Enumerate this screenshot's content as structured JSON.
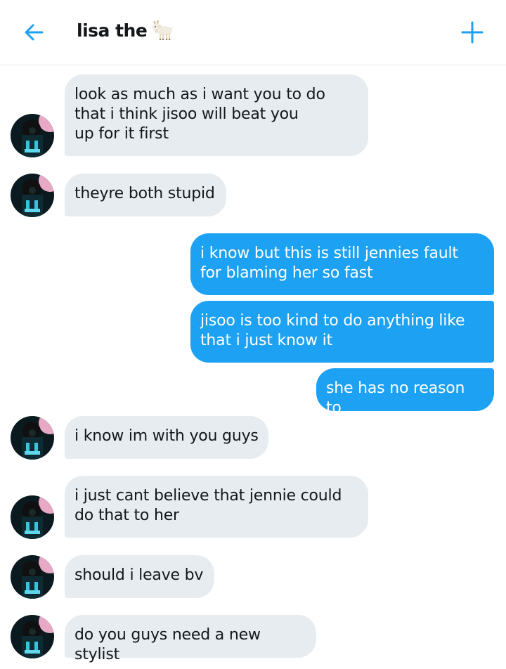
{
  "header": {
    "title": "lisa the",
    "back_icon": "back-arrow-icon",
    "title_icon": "goat-emoji",
    "action_icon": "plus-icon",
    "accent_color": "#1da1f2"
  },
  "messages": [
    {
      "direction": "received",
      "text": "look as much as i want you to do\nthat i think jisoo will beat you\nup for it first"
    },
    {
      "direction": "received",
      "text": "theyre both stupid"
    },
    {
      "direction": "sent",
      "text": "i know but this is still jennies fault\nfor blaming her so fast"
    },
    {
      "direction": "sent",
      "text": "jisoo is too kind to do anything like\nthat i just know it"
    },
    {
      "direction": "sent",
      "text": "she has no reason to"
    },
    {
      "direction": "received",
      "text": "i know im with you guys"
    },
    {
      "direction": "received",
      "text": "i just cant believe that jennie could\ndo that to her"
    },
    {
      "direction": "received",
      "text": "should i leave bv"
    },
    {
      "direction": "received",
      "text": "do you guys need a new stylist"
    }
  ],
  "colors": {
    "received_bubble": "#e6ecf0",
    "sent_bubble": "#1da1f2",
    "divider": "#e1e8ed"
  }
}
